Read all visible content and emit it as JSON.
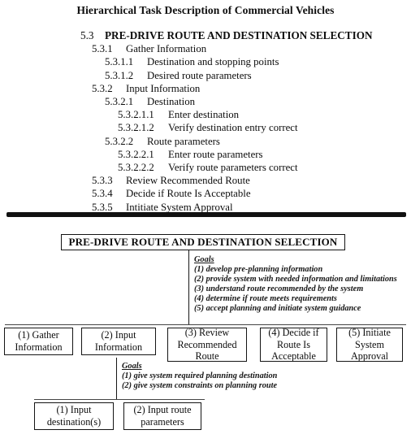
{
  "document": {
    "title": "Hierarchical Task Description of Commercial Vehicles"
  },
  "outline": [
    {
      "level": 0,
      "num": "5.3",
      "text": "PRE-DRIVE ROUTE AND DESTINATION SELECTION"
    },
    {
      "level": 1,
      "num": "5.3.1",
      "text": "Gather Information"
    },
    {
      "level": 2,
      "num": "5.3.1.1",
      "text": "Destination and stopping points"
    },
    {
      "level": 2,
      "num": "5.3.1.2",
      "text": "Desired route parameters"
    },
    {
      "level": 1,
      "num": "5.3.2",
      "text": "Input Information"
    },
    {
      "level": 2,
      "num": "5.3.2.1",
      "text": "Destination"
    },
    {
      "level": 3,
      "num": "5.3.2.1.1",
      "text": "Enter destination"
    },
    {
      "level": 3,
      "num": "5.3.2.1.2",
      "text": "Verify destination entry correct"
    },
    {
      "level": 2,
      "num": "5.3.2.2",
      "text": "Route parameters"
    },
    {
      "level": 3,
      "num": "5.3.2.2.1",
      "text": "Enter route parameters"
    },
    {
      "level": 3,
      "num": "5.3.2.2.2",
      "text": "Verify route parameters correct"
    },
    {
      "level": 1,
      "num": "5.3.3",
      "text": "Review Recommended Route"
    },
    {
      "level": 1,
      "num": "5.3.4",
      "text": "Decide if Route Is Acceptable"
    },
    {
      "level": 1,
      "num": "5.3.5",
      "text": "Intitiate System Approval"
    }
  ],
  "diagram": {
    "title_box": "PRE-DRIVE ROUTE AND DESTINATION SELECTION",
    "goals_main": {
      "heading": "Goals",
      "items": [
        "(1) develop pre-planning information",
        "(2) provide system with needed information and limitations",
        "(3) understand route recommended by the system",
        "(4) determine if route meets requirements",
        "(5) accept planning and initiate system guidance"
      ]
    },
    "boxes": [
      {
        "line1": "(1) Gather",
        "line2": "Information",
        "line3": ""
      },
      {
        "line1": "(2) Input",
        "line2": "Information",
        "line3": ""
      },
      {
        "line1": "(3) Review",
        "line2": "Recommended",
        "line3": "Route"
      },
      {
        "line1": "(4) Decide if",
        "line2": "Route Is",
        "line3": "Acceptable"
      },
      {
        "line1": "(5) Initiate",
        "line2": "System",
        "line3": "Approval"
      }
    ],
    "goals_sub": {
      "heading": "Goals",
      "items": [
        "(1) give system required planning destination",
        "(2) give system constraints on planning route"
      ]
    },
    "sub_boxes": [
      {
        "line1": "(1) Input",
        "line2": "destination(s)"
      },
      {
        "line1": "(2) Input route",
        "line2": "parameters"
      }
    ]
  },
  "colors": {
    "ink": "#111111",
    "rule": "#444444",
    "paper": "#ffffff"
  }
}
